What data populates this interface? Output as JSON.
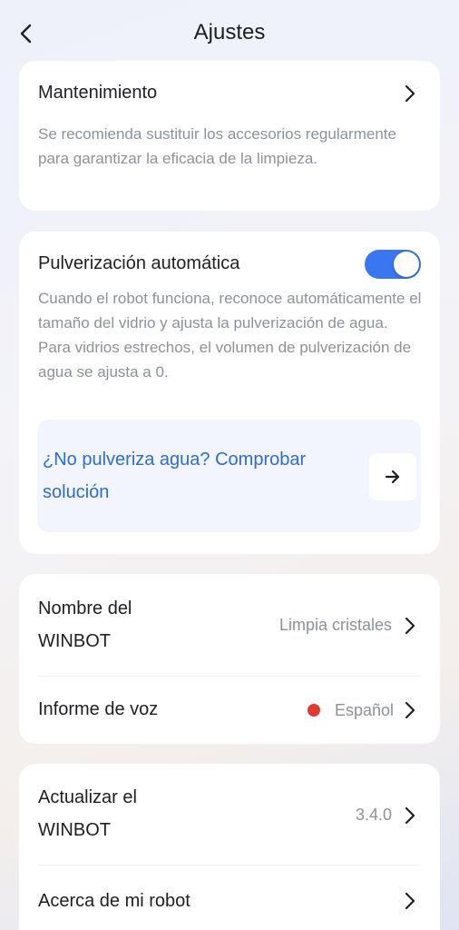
{
  "header": {
    "title": "Ajustes",
    "back_icon": "back-arrow-icon"
  },
  "maintenance": {
    "title": "Mantenimiento",
    "description": "Se recomienda sustituir los accesorios regularmente para garantizar la eficacia de la limpieza."
  },
  "spray": {
    "title": "Pulverización automática",
    "enabled": true,
    "toggle_color": "#3a76ef",
    "description": "Cuando el robot funciona, reconoce automáticamente el tamaño del vidrio y ajusta la pulverización de agua. Para vidrios estrechos, el volumen de pulverización de agua se ajusta a 0.",
    "help_text": "¿No pulveriza agua? Comprobar solución",
    "help_color": "#2e6bd6"
  },
  "device": {
    "name_label": "Nombre del WINBOT",
    "name_value": "Limpia cristales",
    "voice_label": "Informe de voz",
    "voice_value": "Español",
    "voice_status_color": "#e03a32"
  },
  "system": {
    "update_label": "Actualizar el WINBOT",
    "update_value": "3.4.0",
    "about_label": "Acerca de mi robot"
  }
}
